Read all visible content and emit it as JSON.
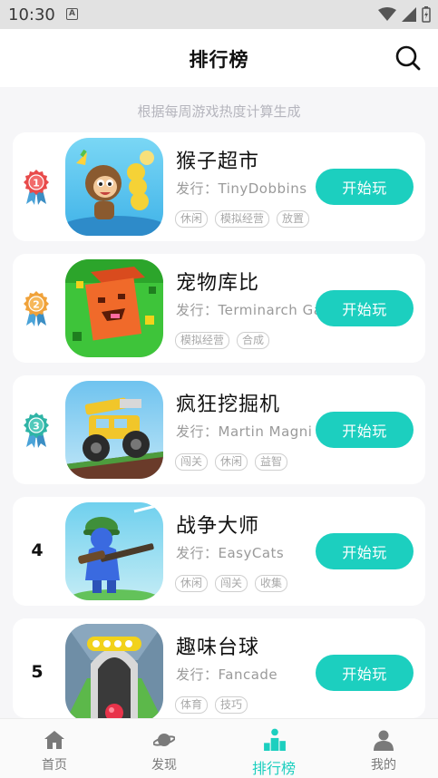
{
  "status_bar": {
    "time": "10:30"
  },
  "header": {
    "title": "排行榜"
  },
  "subtitle": "根据每周游戏热度计算生成",
  "games": [
    {
      "rank": "1",
      "name": "猴子超市",
      "publisher": "发行：TinyDobbins",
      "tags": [
        "休闲",
        "模拟经营",
        "放置"
      ],
      "button": "开始玩"
    },
    {
      "rank": "2",
      "name": "宠物库比",
      "publisher": "发行：Terminarch Games",
      "tags": [
        "模拟经营",
        "合成"
      ],
      "button": "开始玩"
    },
    {
      "rank": "3",
      "name": "疯狂挖掘机",
      "publisher": "发行：Martin Magni",
      "tags": [
        "闯关",
        "休闲",
        "益智"
      ],
      "button": "开始玩"
    },
    {
      "rank": "4",
      "name": "战争大师",
      "publisher": "发行：EasyCats",
      "tags": [
        "休闲",
        "闯关",
        "收集"
      ],
      "button": "开始玩"
    },
    {
      "rank": "5",
      "name": "趣味台球",
      "publisher": "发行：Fancade",
      "tags": [
        "体育",
        "技巧"
      ],
      "button": "开始玩"
    }
  ],
  "tabbar": [
    {
      "label": "首页",
      "icon": "home-icon"
    },
    {
      "label": "发现",
      "icon": "planet-icon"
    },
    {
      "label": "排行榜",
      "icon": "podium-icon"
    },
    {
      "label": "我的",
      "icon": "person-icon"
    }
  ],
  "colors": {
    "accent": "#1ccfbf",
    "medal_gold": "#e84b4b",
    "medal_silver": "#f0a23a",
    "medal_bronze": "#2fb4a6"
  }
}
